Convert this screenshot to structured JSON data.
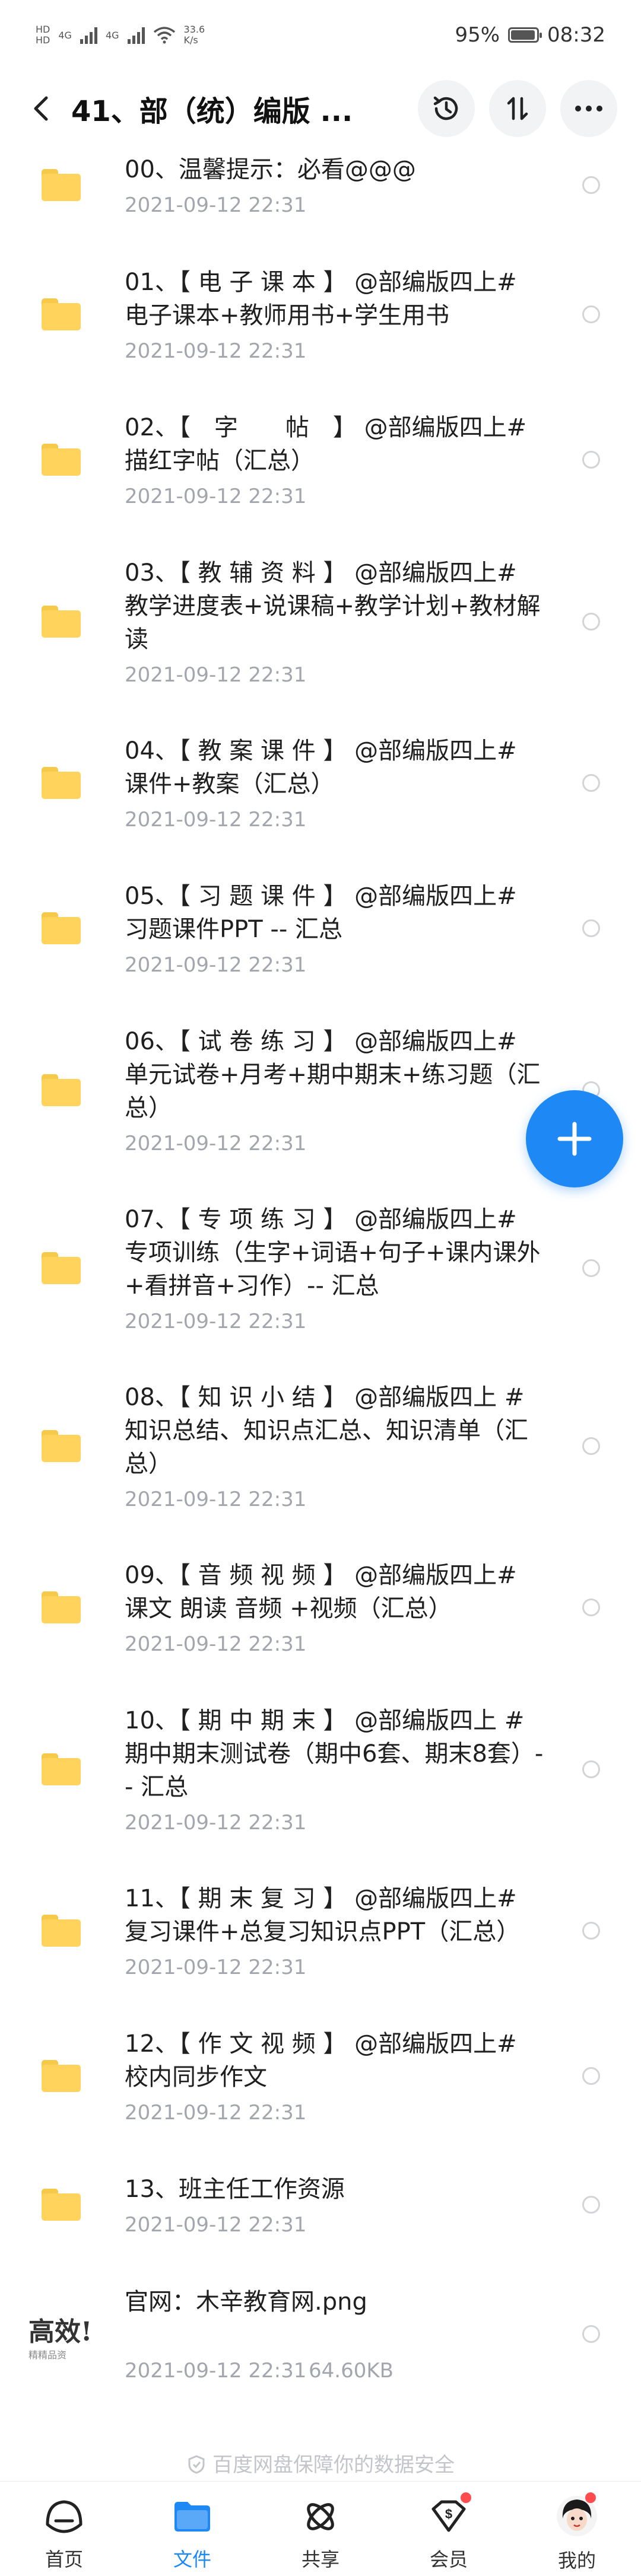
{
  "status_bar": {
    "net1": "HD",
    "net2": "HD",
    "sig1": "4G",
    "sig2": "4G",
    "speed": "33.6",
    "speed_unit": "K/s",
    "battery": "95%",
    "battery_level": 0.95,
    "time": "08:32"
  },
  "header": {
    "title": "41、部（统）编版 ...",
    "icons": [
      "back-arrow-icon",
      "history-icon",
      "sort-icon",
      "more-icon"
    ]
  },
  "files": [
    {
      "title": "00、温馨提示：必看@@@",
      "date": "2021-09-12  22:31",
      "type": "folder"
    },
    {
      "title": "01、【 电 子 课 本 】 @部编版四上# 电子课本+教师用书+学生用书",
      "date": "2021-09-12  22:31",
      "type": "folder"
    },
    {
      "title": "02、【　字　　帖　】 @部编版四上# 描红字帖（汇总）",
      "date": "2021-09-12  22:31",
      "type": "folder"
    },
    {
      "title": "03、【 教 辅 资 料 】 @部编版四上# 教学进度表+说课稿+教学计划+教材解读",
      "date": "2021-09-12  22:31",
      "type": "folder"
    },
    {
      "title": "04、【 教 案 课 件 】 @部编版四上# 课件+教案（汇总）",
      "date": "2021-09-12  22:31",
      "type": "folder"
    },
    {
      "title": "05、【 习 题 课 件 】 @部编版四上# 习题课件PPT -- 汇总",
      "date": "2021-09-12  22:31",
      "type": "folder"
    },
    {
      "title": "06、【 试 卷 练 习 】 @部编版四上# 单元试卷+月考+期中期末+练习题（汇总）",
      "date": "2021-09-12  22:31",
      "type": "folder"
    },
    {
      "title": "07、【 专 项 练 习 】 @部编版四上# 专项训练（生字+词语+句子+课内课外+看拼音+习作）-- 汇总",
      "date": "2021-09-12  22:31",
      "type": "folder"
    },
    {
      "title": "08、【 知 识 小 结 】 @部编版四上 # 知识总结、知识点汇总、知识清单（汇总）",
      "date": "2021-09-12  22:31",
      "type": "folder"
    },
    {
      "title": "09、【 音 频 视 频 】 @部编版四上# 课文 朗读 音频 +视频（汇总）",
      "date": "2021-09-12  22:31",
      "type": "folder"
    },
    {
      "title": "10、【 期 中 期 末 】 @部编版四上 # 期中期末测试卷（期中6套、期末8套）-- 汇总",
      "date": "2021-09-12  22:31",
      "type": "folder"
    },
    {
      "title": "11、【 期 末 复 习 】 @部编版四上# 复习课件+总复习知识点PPT（汇总）",
      "date": "2021-09-12  22:31",
      "type": "folder"
    },
    {
      "title": "12、【 作 文 视 频 】 @部编版四上# 校内同步作文",
      "date": "2021-09-12  22:31",
      "type": "folder"
    },
    {
      "title": "13、班主任工作资源",
      "date": "2021-09-12  22:31",
      "type": "folder"
    },
    {
      "title": "官网：木辛教育网.png",
      "date": "2021-09-12  22:31",
      "size": "64.60KB",
      "type": "image",
      "thumb_text": "高效!",
      "thumb_sub": "精精品资"
    }
  ],
  "footer_notice": "百度网盘保障你的数据安全",
  "tabs": [
    {
      "label": "首页",
      "icon": "home-icon",
      "active": false,
      "badge": false
    },
    {
      "label": "文件",
      "icon": "folder-icon",
      "active": true,
      "badge": false
    },
    {
      "label": "共享",
      "icon": "share-icon",
      "active": false,
      "badge": false
    },
    {
      "label": "会员",
      "icon": "vip-icon",
      "active": false,
      "badge": true
    },
    {
      "label": "我的",
      "icon": "avatar-icon",
      "active": false,
      "badge": true
    }
  ],
  "colors": {
    "accent": "#1E88F5",
    "folder": "#FFD35C",
    "meta": "#a3a6ad",
    "badge": "#ff4d4f"
  }
}
